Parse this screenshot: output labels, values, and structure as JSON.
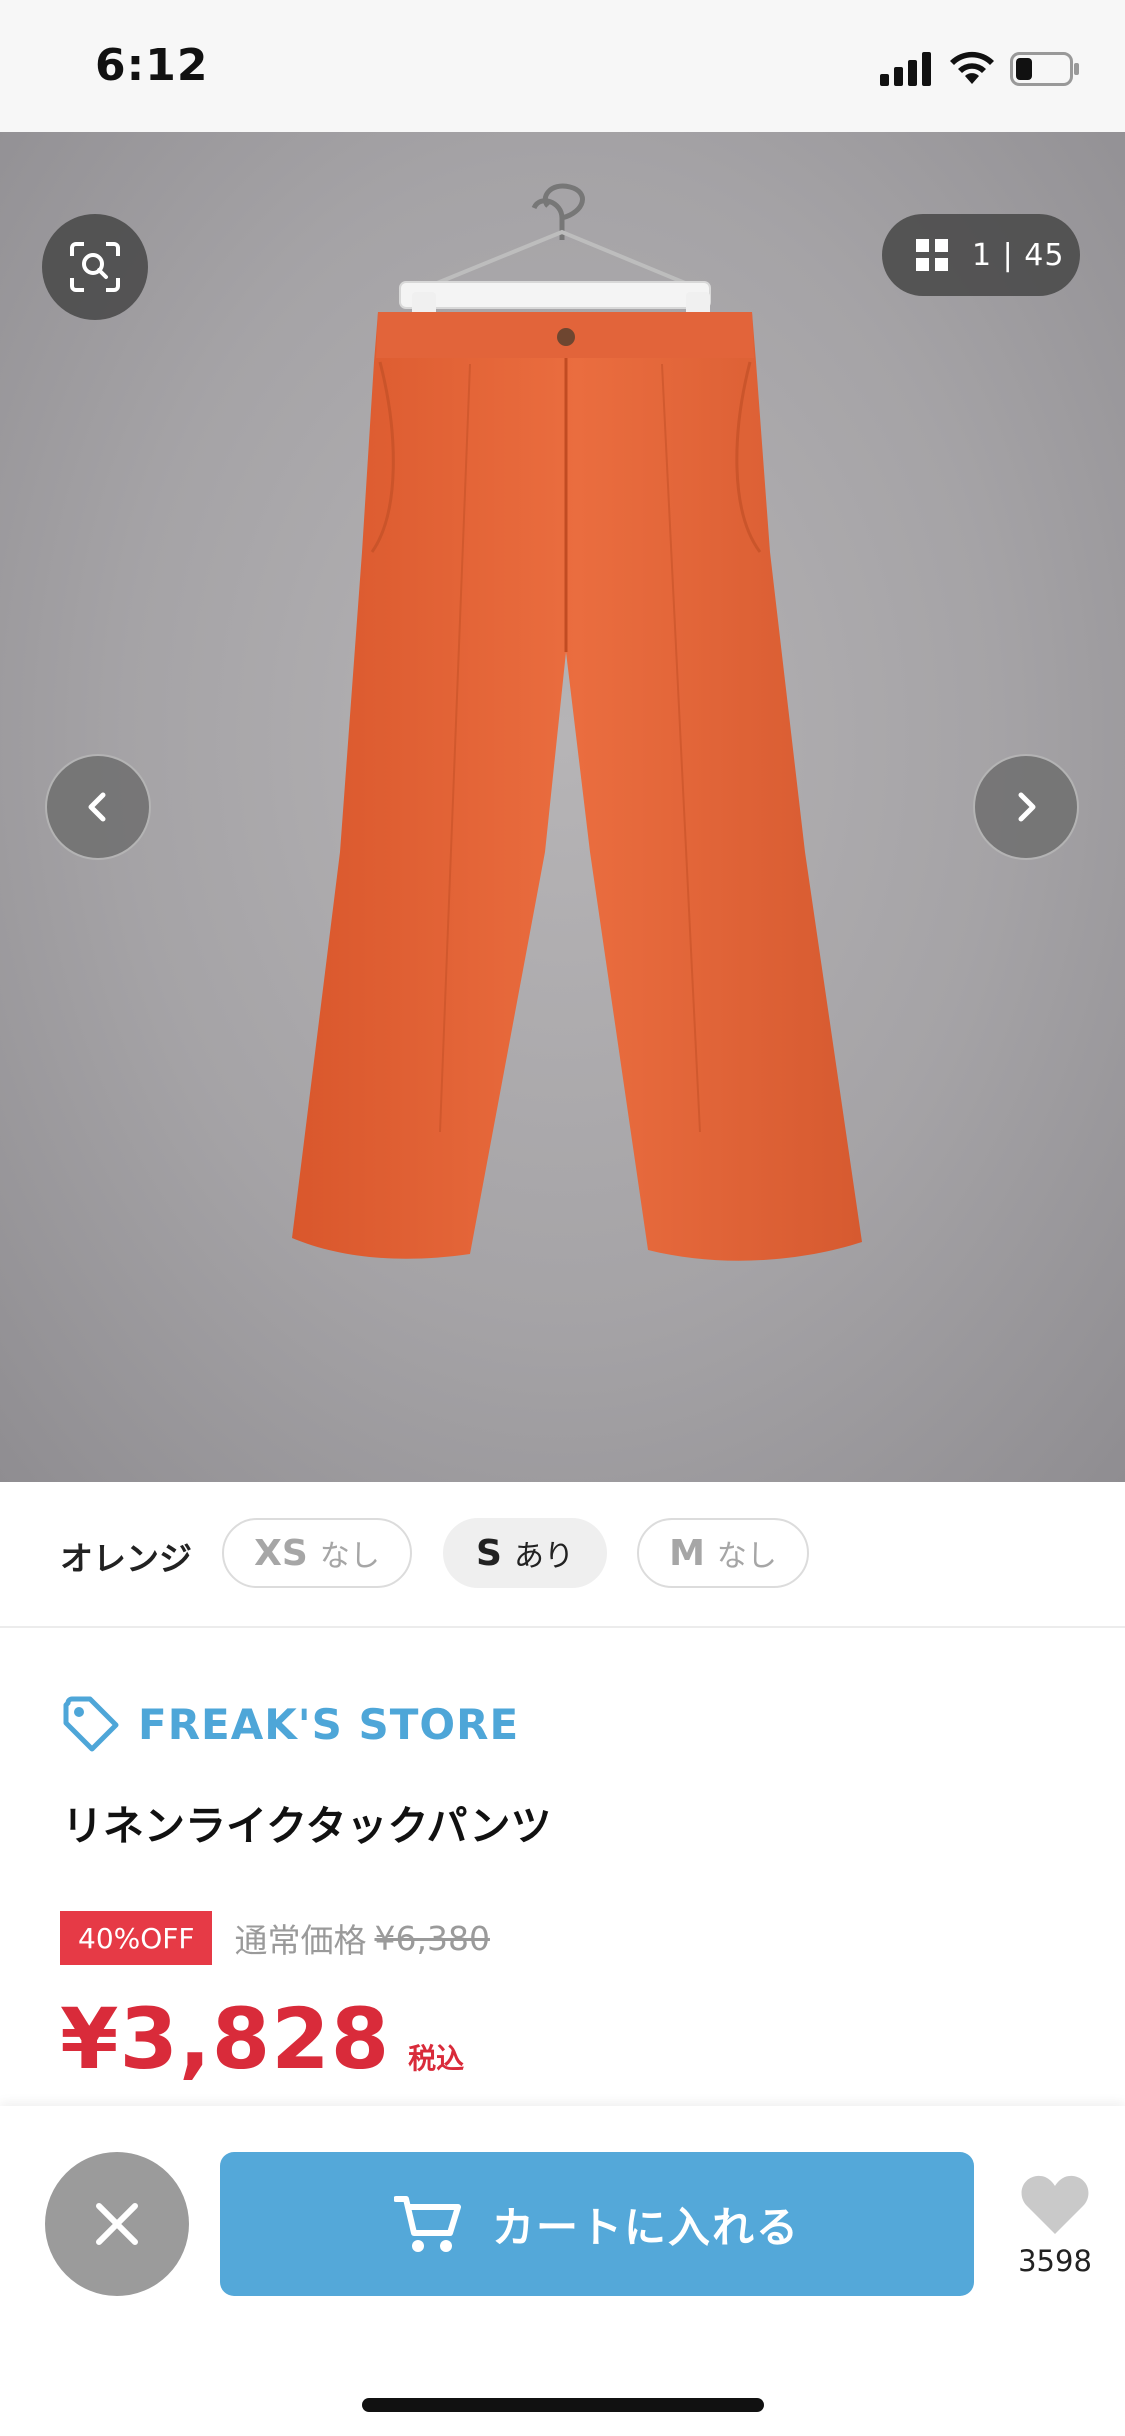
{
  "status_bar": {
    "time": "6:12"
  },
  "gallery": {
    "counter": "1 | 45",
    "icons": {
      "search": "image-search-icon",
      "grid": "grid-icon",
      "prev": "chevron-left-icon",
      "next": "chevron-right-icon"
    },
    "image_subject": "orange wide tuck pants on hanger"
  },
  "variant": {
    "color": "オレンジ",
    "sizes": [
      {
        "size": "XS",
        "stock": "なし",
        "available": false
      },
      {
        "size": "S",
        "stock": "あり",
        "available": true
      },
      {
        "size": "M",
        "stock": "なし",
        "available": false
      }
    ]
  },
  "product": {
    "brand": "FREAK'S STORE",
    "title": "リネンライクタックパンツ",
    "discount_badge": "40%OFF",
    "regular_label": "通常価格",
    "regular_price": "¥6,380",
    "sale_price": "¥3,828",
    "tax_label": "税込"
  },
  "bottom_bar": {
    "cart_label": "カートに入れる",
    "favorite_count": "3598"
  },
  "colors": {
    "brand": "#4ea6d8",
    "cart_button": "#54a8d9",
    "sale": "#d92b3a",
    "badge": "#e63a46",
    "product": "#e4673b"
  }
}
